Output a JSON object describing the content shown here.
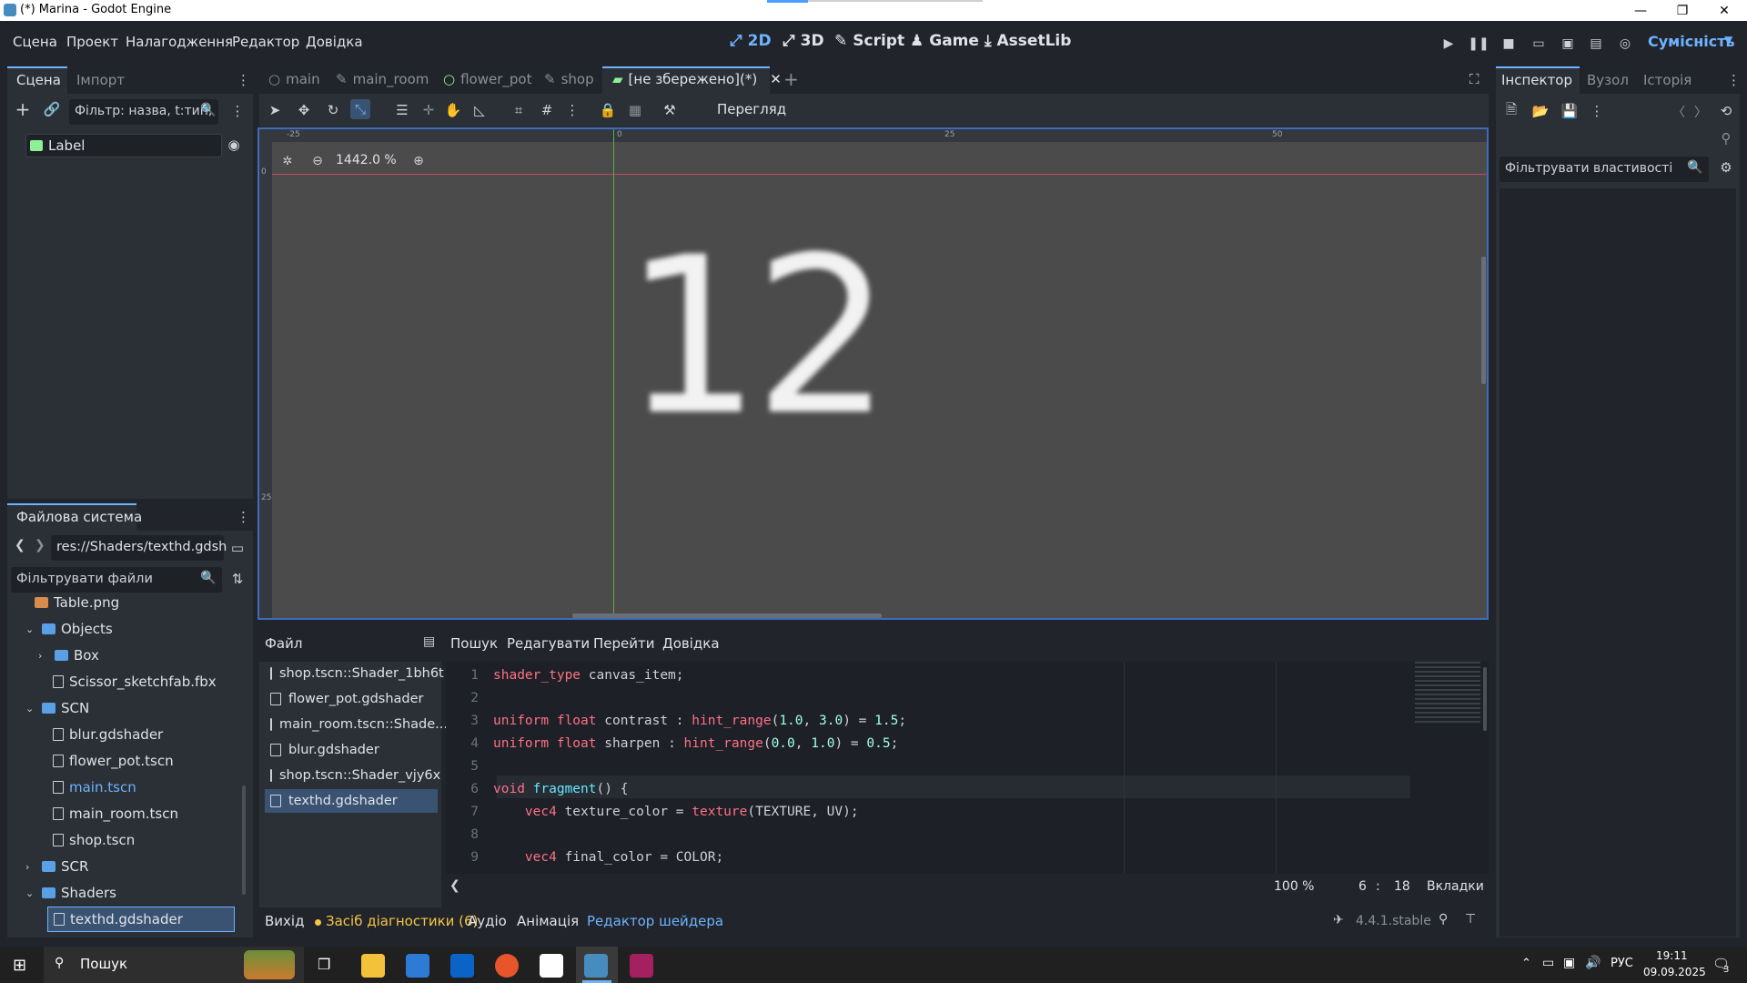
{
  "window": {
    "title": "(*) Marina - Godot Engine"
  },
  "menu": [
    "Сцена",
    "Проект",
    "Налагодження",
    "Редактор",
    "Довідка"
  ],
  "workspaces": [
    "2D",
    "3D",
    "Script",
    "Game",
    "AssetLib"
  ],
  "renderer": "Сумісність",
  "scene_dock": {
    "tabs": [
      "Сцена",
      "Імпорт"
    ],
    "filter_placeholder": "Фільтр: назва, t:тип,",
    "nodes": [
      "Label"
    ]
  },
  "filesystem": {
    "title": "Файлова система",
    "path": "res://Shaders/texthd.gdsh",
    "filter_placeholder": "Фільтрувати файли",
    "items": [
      {
        "name": "Table.png",
        "kind": "image"
      },
      {
        "name": "Objects",
        "kind": "folder"
      },
      {
        "name": "Box",
        "kind": "folder"
      },
      {
        "name": "Scissor_sketchfab.fbx",
        "kind": "file"
      },
      {
        "name": "SCN",
        "kind": "folder"
      },
      {
        "name": "blur.gdshader",
        "kind": "file"
      },
      {
        "name": "flower_pot.tscn",
        "kind": "file"
      },
      {
        "name": "main.tscn",
        "kind": "file"
      },
      {
        "name": "main_room.tscn",
        "kind": "file"
      },
      {
        "name": "shop.tscn",
        "kind": "file"
      },
      {
        "name": "SCR",
        "kind": "folder"
      },
      {
        "name": "Shaders",
        "kind": "folder"
      },
      {
        "name": "texthd.gdshader",
        "kind": "file"
      }
    ]
  },
  "scene_tabs": [
    "main",
    "main_room",
    "flower_pot",
    "shop",
    "[не збережено](*)"
  ],
  "viewport": {
    "zoom": "1442.0 %",
    "preview_label": "Перегляд",
    "ruler_marks": [
      "-25",
      "0",
      "25",
      "50"
    ],
    "ruler_v_marks": [
      "0",
      "25"
    ],
    "content_text": "12"
  },
  "shader_editor": {
    "menu": [
      "Файл",
      "Пошук",
      "Редагувати",
      "Перейти",
      "Довідка"
    ],
    "files": [
      "shop.tscn::Shader_1bh6t",
      "flower_pot.gdshader",
      "main_room.tscn::Shade...",
      "blur.gdshader",
      "shop.tscn::Shader_vjy6x",
      "texthd.gdshader"
    ],
    "zoom": "100 %",
    "line": "6",
    "col": "18",
    "indent": "Вкладки"
  },
  "bottom_tabs": [
    "Вихід",
    "Засіб діагностики (6)",
    "Аудіо",
    "Анімація",
    "Редактор шейдера"
  ],
  "version": "4.4.1.stable",
  "inspector": {
    "tabs": [
      "Інспектор",
      "Вузол",
      "Історія"
    ],
    "filter_placeholder": "Фільтрувати властивості"
  },
  "taskbar": {
    "search": "Пошук",
    "lang": "РУС",
    "time": "19:11",
    "date": "09.09.2025",
    "notifications": "3"
  },
  "colors": {
    "accent": "#6db3ff",
    "bg": "#21252b",
    "panel": "#2b2f36",
    "viewport": "#4b4b4b"
  }
}
